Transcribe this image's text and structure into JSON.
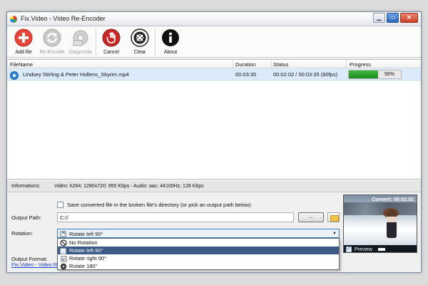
{
  "window": {
    "title": "Fix.Video - Video Re-Encoder"
  },
  "window_buttons": {
    "minimize": "▁",
    "maximize": "▭",
    "close": "✕"
  },
  "toolbar": {
    "add_file": "Add file",
    "re_encode": "Re-Encode",
    "diagnostic": "Diagnostic",
    "cancel": "Cancel",
    "clear": "Clear",
    "about": "About"
  },
  "filelist": {
    "headers": {
      "filename": "FileName",
      "duration": "Duration",
      "status": "Status",
      "progress": "Progress"
    },
    "rows": [
      {
        "filename": "Lindsey Stirling  & Peter Hollens_Skyrim.mp4",
        "duration": "00:03:35",
        "status": "00:02:02 / 00:03:35 (80fps)",
        "progress_label": "56%",
        "progress_value": 0.56
      }
    ]
  },
  "info": {
    "label": "Informations:",
    "text": "Video: h264; 1280x720; 950 Kbps - Audio: aac; 44100Hz; 128 Kbps"
  },
  "settings": {
    "save_in_broken_dir_label": "Save converted file in the broken file's directory (or pick an output path below)",
    "output_path_label": "Output Path:",
    "output_path_value": "C://",
    "browse_label": "...",
    "rotation_label": "Rotation:",
    "rotation_selected": "Rotate left 90°",
    "rotation_options": [
      "No Rotation",
      "Rotate left 90°",
      "Rotate right 90°",
      "Rotate 180°"
    ],
    "output_format_label": "Output Format:",
    "status_link": "Fix.Video - Video Re-Encoder"
  },
  "preview": {
    "convert_text": "Convert: 00:02:02",
    "preview_label": "Preview"
  },
  "colors": {
    "accent_blue": "#3b5a86",
    "progress_green": "#2a9a2a",
    "add_red": "#e8453c",
    "cancel_red": "#c62828"
  }
}
